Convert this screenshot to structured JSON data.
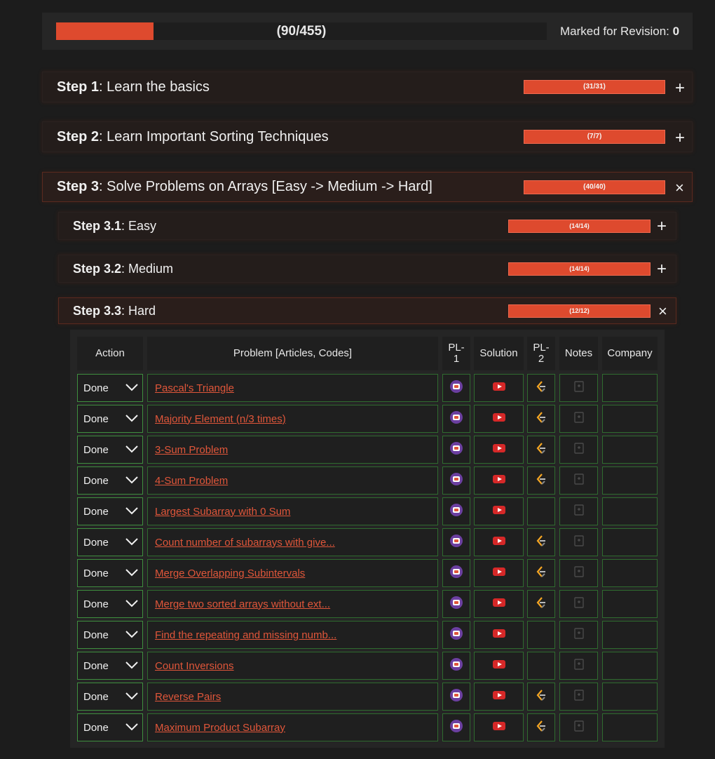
{
  "progress": {
    "count_text": "(90/455)",
    "fraction": 0.198,
    "revision_label": "Marked for Revision:",
    "revision_count": "0"
  },
  "steps": [
    {
      "num": "Step 1",
      "name": " : Learn the basics",
      "bar_text": "(31/31)",
      "toggle": "+"
    },
    {
      "num": "Step 2",
      "name": " : Learn Important Sorting Techniques",
      "bar_text": "(7/7)",
      "toggle": "+"
    },
    {
      "num": "Step 3",
      "name": " : Solve Problems on Arrays [Easy -> Medium -> Hard]",
      "bar_text": "(40/40)",
      "toggle": "×"
    }
  ],
  "substeps": [
    {
      "num": "Step 3.1",
      "name": " : Easy",
      "bar_text": "(14/14)",
      "toggle": "+"
    },
    {
      "num": "Step 3.2",
      "name": " : Medium",
      "bar_text": "(14/14)",
      "toggle": "+"
    },
    {
      "num": "Step 3.3",
      "name": " : Hard",
      "bar_text": "(12/12)",
      "toggle": "×"
    }
  ],
  "table": {
    "headers": {
      "action": "Action",
      "problem": "Problem [Articles, Codes]",
      "pl1a": "PL-",
      "pl1b": "1",
      "solution": "Solution",
      "pl2a": "PL-",
      "pl2b": "2",
      "notes": "Notes",
      "company": "Company"
    },
    "rows": [
      {
        "action": "Done",
        "problem": "Pascal's Triangle",
        "pl2": true
      },
      {
        "action": "Done",
        "problem": "Majority Element (n/3 times)",
        "pl2": true
      },
      {
        "action": "Done",
        "problem": "3-Sum Problem",
        "pl2": true
      },
      {
        "action": "Done",
        "problem": "4-Sum Problem",
        "pl2": true
      },
      {
        "action": "Done",
        "problem": "Largest Subarray with 0 Sum",
        "pl2": false
      },
      {
        "action": "Done",
        "problem": "Count number of subarrays with give...",
        "pl2": true
      },
      {
        "action": "Done",
        "problem": "Merge Overlapping Subintervals",
        "pl2": true
      },
      {
        "action": "Done",
        "problem": "Merge two sorted arrays without ext...",
        "pl2": true
      },
      {
        "action": "Done",
        "problem": "Find the repeating and missing numb...",
        "pl2": false
      },
      {
        "action": "Done",
        "problem": "Count Inversions",
        "pl2": false
      },
      {
        "action": "Done",
        "problem": "Reverse Pairs",
        "pl2": true
      },
      {
        "action": "Done",
        "problem": "Maximum Product Subarray",
        "pl2": true
      }
    ]
  },
  "colors": {
    "accent": "#de4a2e",
    "link": "#e0563a",
    "cell_border": "#2f6b2f",
    "pl1_icon": "#6b3fa0",
    "youtube": "#d62828",
    "leetcode": "#f5a623"
  }
}
